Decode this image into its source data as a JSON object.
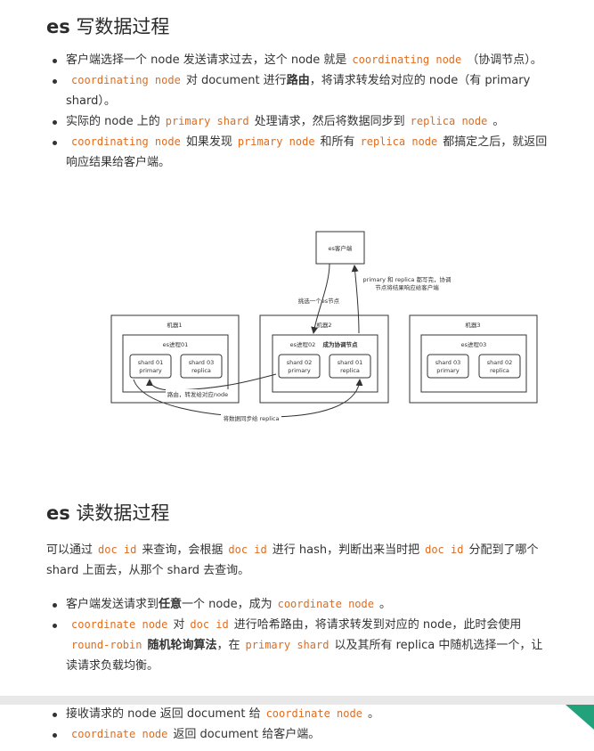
{
  "write": {
    "heading_es": "es",
    "heading_rest": " 写数据过程",
    "items": [
      {
        "a": "客户端选择一个 node 发送请求过去，这个 node 就是",
        "b": "coordinating node",
        "c": "（协调节点）。"
      },
      {
        "b0": "coordinating node",
        "a": "对 document 进行",
        "strong": "路由",
        "c": "，将请求转发给对应的 node（有 primary shard）。"
      },
      {
        "a": "实际的 node 上的",
        "b": "primary shard",
        "c": "处理请求，然后将数据同步到",
        "d": "replica node",
        "e": "。"
      },
      {
        "b0": "coordinating node",
        "a": "如果发现",
        "b": "primary node",
        "c": "和所有",
        "d": "replica node",
        "e": "都搞定之后，就返回响应结果给客户端。"
      }
    ]
  },
  "diagram": {
    "client": "es客户端",
    "note_line1": "primary 和 replica 都写完，协调",
    "note_line2": "节点将结果响应给客户端",
    "pick_label": "挑选一个es节点",
    "machine1": "机器1",
    "machine2": "机器2",
    "machine3": "机器3",
    "proc1": "es进程01",
    "proc2": "es进程02",
    "proc2_role": "成为协调节点",
    "proc3": "es进程03",
    "m1_shard_a_1": "shard 01",
    "m1_shard_a_2": "primary",
    "m1_shard_b_1": "shard 03",
    "m1_shard_b_2": "replica",
    "m2_shard_a_1": "shard 02",
    "m2_shard_a_2": "primary",
    "m2_shard_b_1": "shard 01",
    "m2_shard_b_2": "replica",
    "m3_shard_a_1": "shard 03",
    "m3_shard_a_2": "primary",
    "m3_shard_b_1": "shard 02",
    "m3_shard_b_2": "replica",
    "route_label": "路由，转发给对应node",
    "sync_label": "将数据同步给 replica"
  },
  "read": {
    "heading_es": "es",
    "heading_rest": " 读数据过程",
    "para": {
      "a": "可以通过",
      "b": "doc id",
      "c": "来查询，会根据",
      "d": "doc id",
      "e": "进行 hash，判断出来当时把",
      "f": "doc id",
      "g": "分配到了哪个 shard 上面去，从那个 shard 去查询。"
    },
    "items": [
      {
        "a": "客户端发送请求到",
        "strong": "任意",
        "a2": "一个 node，成为",
        "b": "coordinate node",
        "c": "。"
      },
      {
        "b0": "coordinate node",
        "a": "对",
        "b": "doc id",
        "c": "进行哈希路由，将请求转发到对应的 node，此时会使用",
        "d": "round-robin",
        "strong": "随机轮询算法",
        "e": "，在",
        "f": "primary shard",
        "g": "以及其所有 replica 中随机选择一个，让读请求负载均衡。"
      },
      {
        "a": "接收请求的 node 返回 document 给",
        "b": "coordinate node",
        "c": "。"
      },
      {
        "b0": "coordinate node",
        "a": "返回 document 给客户端。"
      }
    ]
  },
  "colors": {
    "code": "#e06c1f",
    "accent": "#22a27b"
  }
}
